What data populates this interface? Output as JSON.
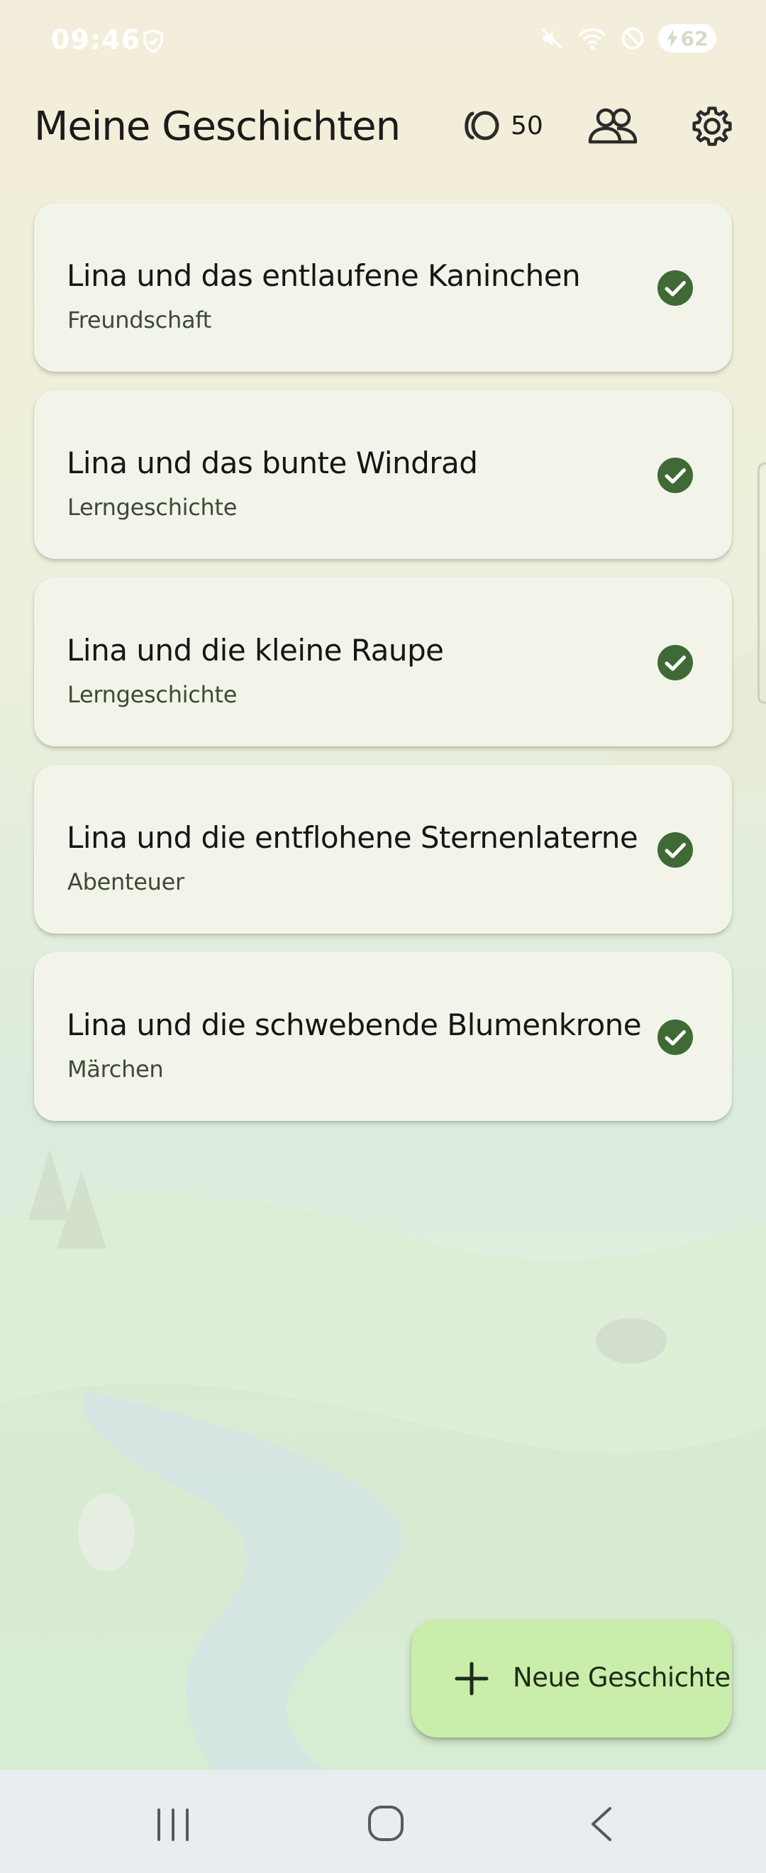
{
  "status_bar": {
    "time": "09:46",
    "battery_level": "62",
    "icons": [
      "shield-check-icon",
      "mute-icon",
      "wifi-icon",
      "do-not-disturb-icon",
      "battery-charging-icon"
    ]
  },
  "header": {
    "title": "Meine Geschichten",
    "credits_value": "50",
    "credits_icon": "coin-icon",
    "family_icon": "people-icon",
    "settings_icon": "gear-icon"
  },
  "stories": [
    {
      "title": "Lina und das entlaufene Kaninchen",
      "category": "Freundschaft",
      "status_icon": "check-circle-icon"
    },
    {
      "title": "Lina und das bunte Windrad",
      "category": "Lerngeschichte",
      "status_icon": "check-circle-icon"
    },
    {
      "title": "Lina und die kleine Raupe",
      "category": "Lerngeschichte",
      "status_icon": "check-circle-icon"
    },
    {
      "title": "Lina und die entflohene Sternenlaterne",
      "category": "Abenteuer",
      "status_icon": "check-circle-icon"
    },
    {
      "title": "Lina und die schwebende Blumenkrone",
      "category": "Märchen",
      "status_icon": "check-circle-icon"
    }
  ],
  "fab": {
    "label": "Neue Geschichte",
    "icon": "plus-icon"
  },
  "nav_bar": {
    "icons": [
      "recents-icon",
      "home-icon",
      "back-icon"
    ]
  },
  "colors": {
    "accent": "#3f6a35",
    "card_background": "#f2f4ea",
    "fab_background": "#c8eeaa",
    "nav_background": "#e9edf0"
  }
}
